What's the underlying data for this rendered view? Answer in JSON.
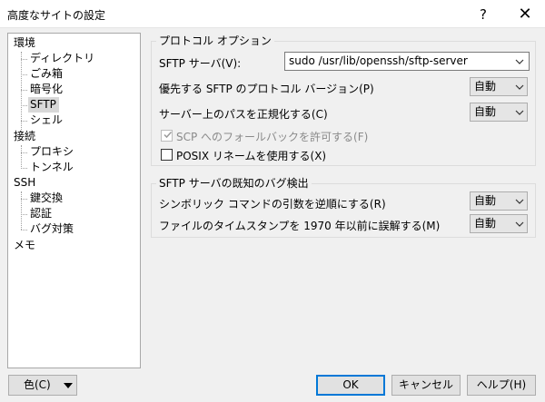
{
  "window": {
    "title": "高度なサイトの設定",
    "help_label": "?",
    "close_label": "✕"
  },
  "tree": {
    "items": [
      {
        "label": "環境"
      },
      {
        "label": "ディレクトリ"
      },
      {
        "label": "ごみ箱"
      },
      {
        "label": "暗号化"
      },
      {
        "label": "SFTP"
      },
      {
        "label": "シェル"
      },
      {
        "label": "接続"
      },
      {
        "label": "プロキシ"
      },
      {
        "label": "トンネル"
      },
      {
        "label": "SSH"
      },
      {
        "label": "鍵交換"
      },
      {
        "label": "認証"
      },
      {
        "label": "バグ対策"
      },
      {
        "label": "メモ"
      }
    ]
  },
  "protocol_options": {
    "legend": "プロトコル オプション",
    "sftp_server_label": "SFTP サーバ(V):",
    "sftp_server_value": "sudo /usr/lib/openssh/sftp-server",
    "preferred_version_label": "優先する SFTP のプロトコル バージョン(P)",
    "preferred_version_value": "自動",
    "canonicalize_label": "サーバー上のパスを正規化する(C)",
    "canonicalize_value": "自動",
    "scp_fallback_label": "SCP へのフォールバックを許可する(F)",
    "scp_fallback_checked": true,
    "posix_rename_label": "POSIX リネームを使用する(X)",
    "posix_rename_checked": false
  },
  "bug_detection": {
    "legend": "SFTP サーバの既知のバグ検出",
    "symlink_label": "シンボリック コマンドの引数を逆順にする(R)",
    "symlink_value": "自動",
    "timestamp_label": "ファイルのタイムスタンプを 1970 年以前に誤解する(M)",
    "timestamp_value": "自動"
  },
  "buttons": {
    "color_label": "色(C)",
    "ok_label": "OK",
    "cancel_label": "キャンセル",
    "help_label": "ヘルプ(H)"
  },
  "colors": {
    "selected_bg": "#d8d8d8",
    "default_button_border": "#0078d7"
  }
}
